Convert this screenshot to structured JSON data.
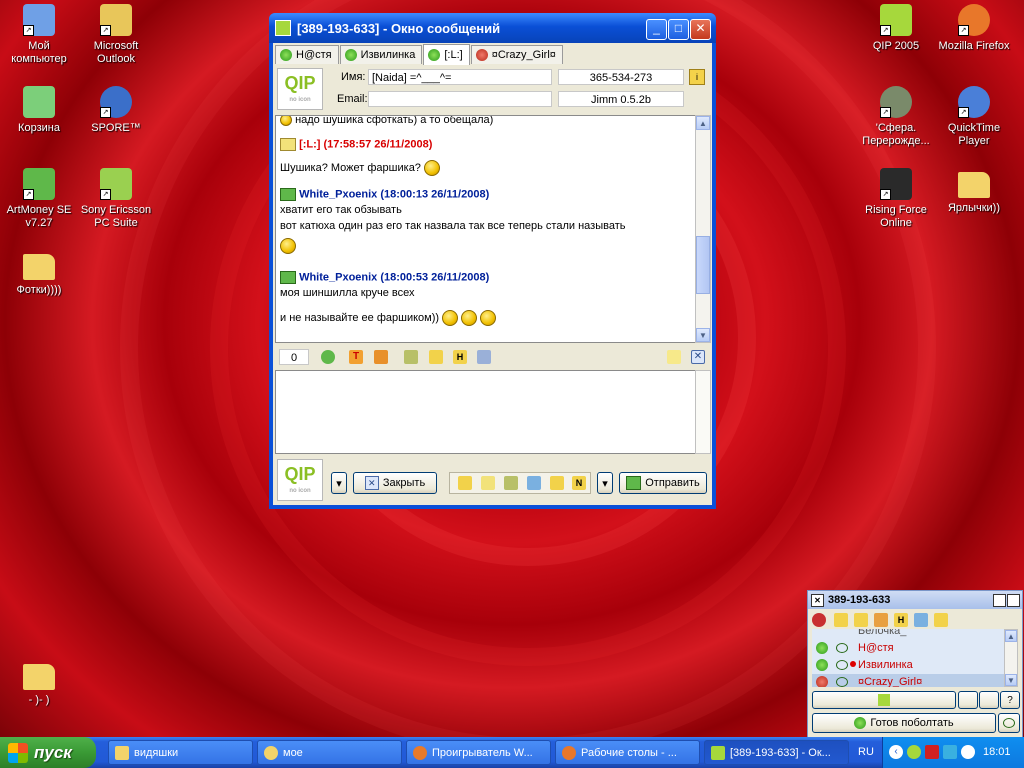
{
  "desktop": {
    "icons_left": [
      {
        "label": "Мой компьютер",
        "icon": "computer-icon",
        "color": "#6fa0e6"
      },
      {
        "label": "Microsoft Outlook",
        "icon": "outlook-icon",
        "color": "#e8c65a"
      },
      {
        "label": "Корзина",
        "icon": "recycle-bin-icon",
        "color": "#7ccf7a"
      },
      {
        "label": "SPORE™",
        "icon": "spore-icon",
        "color": "#3b6fc9"
      },
      {
        "label": "ArtMoney SE v7.27",
        "icon": "artmoney-icon",
        "color": "#5fb84a"
      },
      {
        "label": "Sony Ericsson PC Suite",
        "icon": "sony-ericsson-icon",
        "color": "#9ad050"
      },
      {
        "label": "Фотки))))",
        "icon": "folder-icon",
        "color": "#f3d36a"
      },
      {
        "label": "- )- )",
        "icon": "folder-icon",
        "color": "#f3d36a"
      }
    ],
    "icons_right": [
      {
        "label": "QIP 2005",
        "icon": "qip-icon",
        "color": "#a6d83c"
      },
      {
        "label": "Mozilla Firefox",
        "icon": "firefox-icon",
        "color": "#e8772a"
      },
      {
        "label": "'Сфера. Перерожде...",
        "icon": "sfera-icon",
        "color": "#7a8a6a"
      },
      {
        "label": "QuickTime Player",
        "icon": "quicktime-icon",
        "color": "#4a7fd8"
      },
      {
        "label": "Rising Force Online",
        "icon": "rising-force-icon",
        "color": "#2a2a2a"
      },
      {
        "label": "Ярлычки))",
        "icon": "folder-icon",
        "color": "#f3d36a"
      }
    ]
  },
  "chat_window": {
    "title": "[389-193-633] - Окно сообщений",
    "tabs": [
      {
        "label": "Н@стя",
        "active": false
      },
      {
        "label": "Извилинка",
        "active": false
      },
      {
        "label": "[:L:]",
        "active": true
      },
      {
        "label": "¤Crazy_Girl¤",
        "active": false
      }
    ],
    "info": {
      "name_label": "Имя:",
      "name_value": "[Naida]  =^___^=",
      "uin": "365-534-273",
      "email_label": "Email:",
      "email_value": "",
      "client": "Jimm 0.5.2b",
      "logo_text": "QIP",
      "logo_sub": "no icon"
    },
    "messages": [
      {
        "type": "text",
        "text": "надо шушика сфоткать) а то обещала)"
      },
      {
        "type": "header",
        "author": "[:L:]",
        "time": "(17:58:57 26/11/2008)",
        "color": "#d80000"
      },
      {
        "type": "text",
        "text": "Шушика? Может фаршика?"
      },
      {
        "type": "header",
        "author": "White_Pxoenix",
        "time": "(18:00:13 26/11/2008)",
        "color": "#00209a"
      },
      {
        "type": "text",
        "text": "хватит его так обзывать"
      },
      {
        "type": "text",
        "text": "вот катюха один раз его так назвала так все теперь стали называть"
      },
      {
        "type": "header",
        "author": "White_Pxoenix",
        "time": "(18:00:53 26/11/2008)",
        "color": "#00209a"
      },
      {
        "type": "text",
        "text": "моя шиншилла круче всех"
      },
      {
        "type": "text",
        "text": "и не называйте ее фаршиком))"
      }
    ],
    "char_count": "0",
    "close_button": "Закрыть",
    "send_button": "Отправить"
  },
  "qip": {
    "title": "389-193-633",
    "contacts": [
      {
        "label": "Белочка_"
      },
      {
        "label": "Н@стя"
      },
      {
        "label": "Извилинка"
      },
      {
        "label": "¤Crazy_Girl¤"
      }
    ],
    "status_button": "Готов поболтать"
  },
  "taskbar": {
    "start_label": "пуск",
    "items": [
      {
        "label": "видяшки",
        "icon": "folder-icon",
        "color": "#f3d36a",
        "active": false
      },
      {
        "label": "мое",
        "icon": "star-icon",
        "color": "#f3d36a",
        "active": false
      },
      {
        "label": "Проигрыватель W...",
        "icon": "media-player-icon",
        "color": "#e87a2a",
        "active": false
      },
      {
        "label": "Рабочие столы - ...",
        "icon": "firefox-icon",
        "color": "#e8772a",
        "active": false
      },
      {
        "label": "[389-193-633] - Ок...",
        "icon": "qip-icon",
        "color": "#a6d83c",
        "active": true
      }
    ],
    "lang": "RU",
    "clock": "18:01"
  }
}
